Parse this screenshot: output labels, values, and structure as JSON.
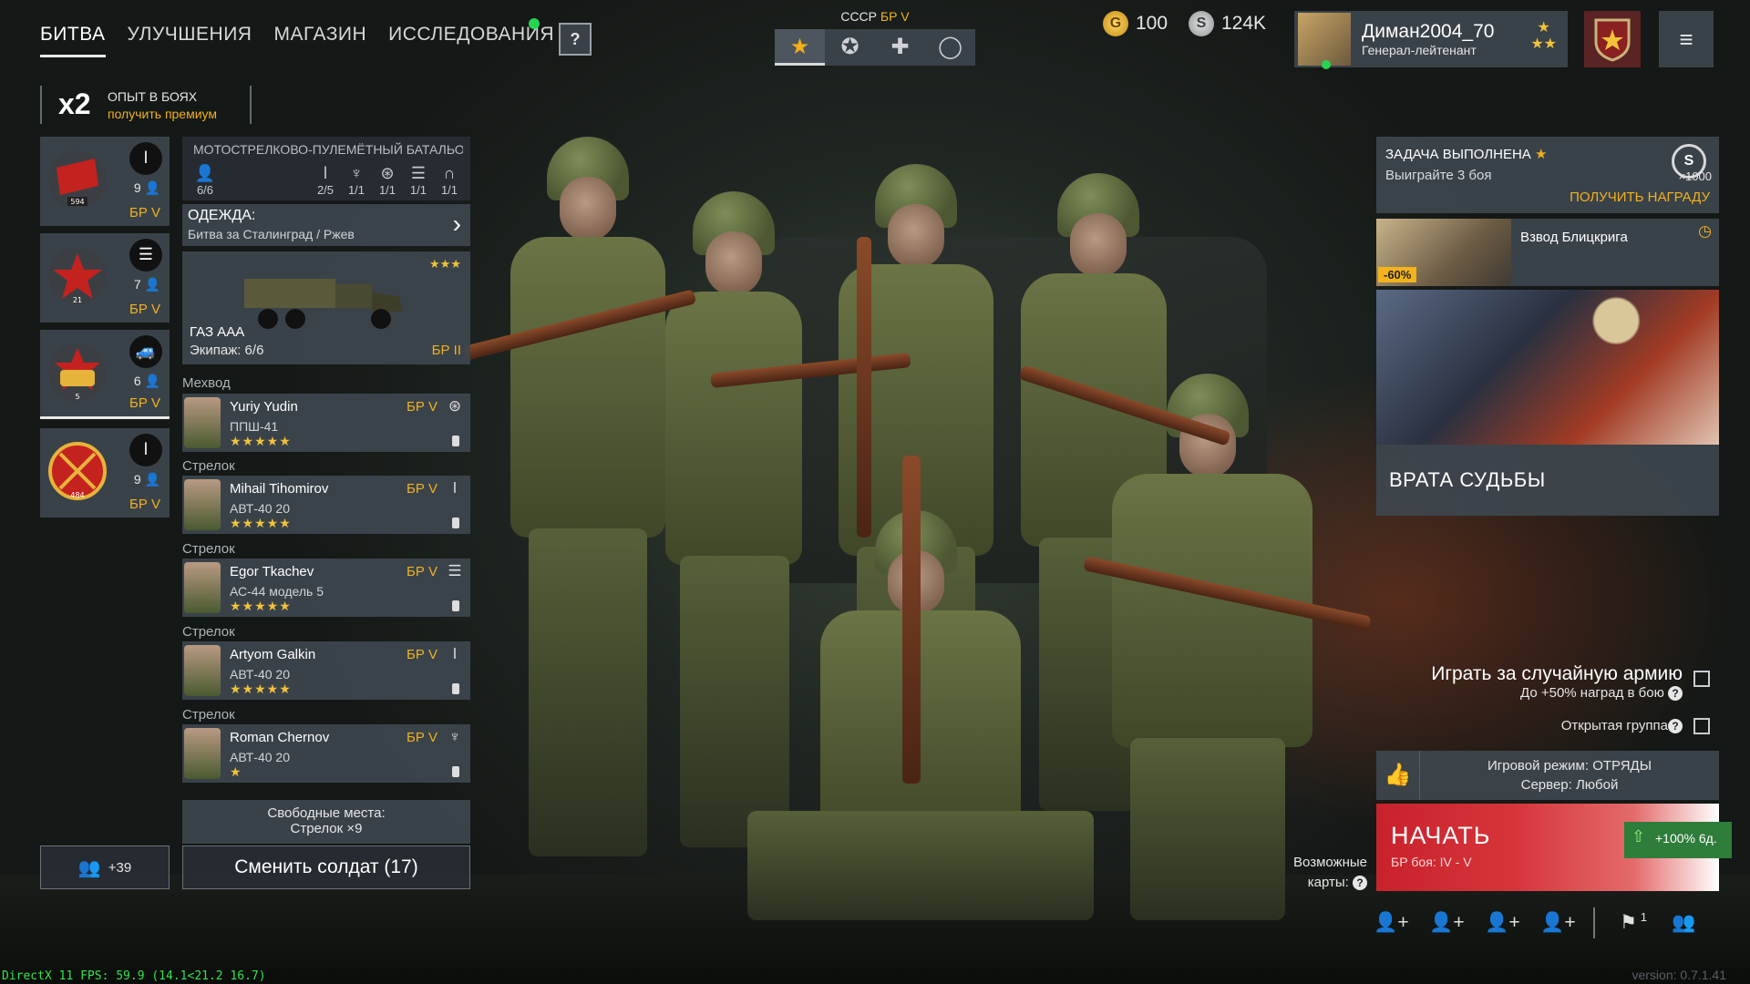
{
  "nav": {
    "tabs": [
      "БИТВА",
      "УЛУЧШЕНИЯ",
      "МАГАЗИН",
      "ИССЛЕДОВАНИЯ"
    ],
    "help": "?"
  },
  "nation": {
    "label": "СССР",
    "br": "БР V",
    "icons": [
      "soviet-star-icon",
      "german-cross-icon",
      "usa-star-icon",
      "japan-circle-icon"
    ]
  },
  "currency": {
    "gold": "100",
    "silver": "124K"
  },
  "profile": {
    "name": "Диман2004_70",
    "rank": "Генерал-лейтенант"
  },
  "xp_boost": {
    "multiplier": "x2",
    "label": "ОПЫТ В БОЯХ",
    "link": "получить премиум"
  },
  "squads": [
    {
      "count": "9",
      "br": "БР V",
      "emblem_num": "594",
      "class_icon": "rifle-icon"
    },
    {
      "count": "7",
      "br": "БР V",
      "emblem_num": "21",
      "class_icon": "radio-icon"
    },
    {
      "count": "6",
      "br": "БР V",
      "emblem_num": "5",
      "class_icon": "vehicle-icon"
    },
    {
      "count": "9",
      "br": "БР V",
      "emblem_num": "484",
      "class_icon": "rifle-icon"
    }
  ],
  "invite": {
    "count": "+39"
  },
  "squad_detail": {
    "name": "МОТОСТРЕЛКОВО-ПУЛЕМЁТНЫЙ БАТАЛЬОН",
    "members": "6/6",
    "stats": [
      "2/5",
      "1/1",
      "1/1",
      "1/1",
      "1/1"
    ]
  },
  "outfit": {
    "title": "ОДЕЖДА:",
    "value": "Битва за Сталинград / Ржев"
  },
  "vehicle": {
    "name": "ГАЗ ААА",
    "crew": "Экипаж: 6/6",
    "br": "БР II",
    "stars": "★★★"
  },
  "soldiers": [
    {
      "role": "Мехвод",
      "name": "Yuriy Yudin",
      "weapon": "ППШ-41",
      "stars": "★★★★★",
      "br": "БР V"
    },
    {
      "role": "Стрелок",
      "name": "Mihail Tihomirov",
      "weapon": "АВТ-40 20",
      "stars": "★★★★★",
      "br": "БР V"
    },
    {
      "role": "Стрелок",
      "name": "Egor Tkachev",
      "weapon": "АС-44 модель 5",
      "stars": "★★★★★",
      "br": "БР V"
    },
    {
      "role": "Стрелок",
      "name": "Artyom Galkin",
      "weapon": "АВТ-40 20",
      "stars": "★★★★★",
      "br": "БР V"
    },
    {
      "role": "Стрелок",
      "name": "Roman Chernov",
      "weapon": "АВТ-40 20",
      "stars": "★",
      "br": "БР V"
    }
  ],
  "free_slots": {
    "line1": "Свободные места:",
    "line2": "Стрелок ×9"
  },
  "swap_button": "Сменить солдат (17)",
  "task": {
    "title": "ЗАДАЧА ВЫПОЛНЕНА",
    "desc": "Выиграйте 3 боя",
    "reward_link": "ПОЛУЧИТЬ НАГРАДУ",
    "amount": "×1000"
  },
  "offer": {
    "title": "Взвод Блицкрига",
    "discount": "-60%"
  },
  "event": {
    "title": "ВРАТА СУДЬБЫ"
  },
  "options": {
    "random_army": "Играть за случайную армию",
    "random_hint": "До +50% наград в бою",
    "open_group": "Открытая группа"
  },
  "mode": {
    "line1": "Игровой режим: ОТРЯДЫ",
    "line2": "Сервер: Любой"
  },
  "start": {
    "title": "НАЧАТЬ",
    "sub": "БР боя: IV - V",
    "xp": "+100% 6д."
  },
  "maps": {
    "line1": "Возможные",
    "line2": "карты:"
  },
  "flag_badge": "1",
  "fps": "DirectX 11 FPS: 59.9 (14.1<21.2 16.7)",
  "version": "version: 0.7.1.41"
}
